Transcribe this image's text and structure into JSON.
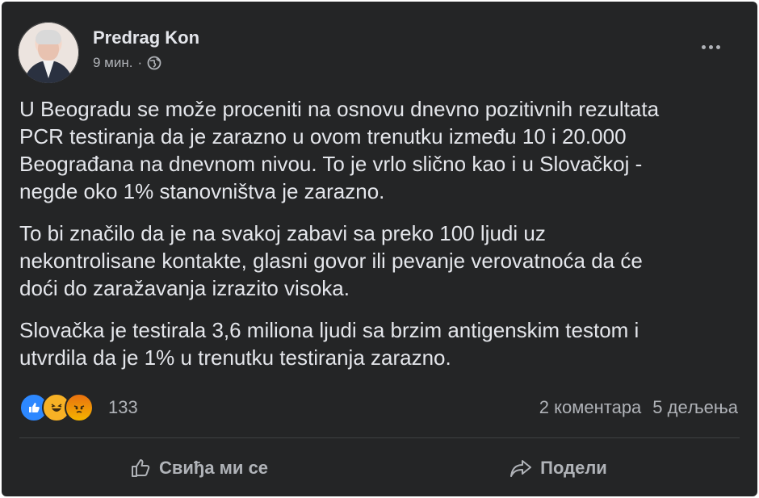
{
  "post": {
    "author": "Predrag Kon",
    "time": "9 мин.",
    "separator": "·",
    "visibility_icon": "globe-icon",
    "paragraphs": [
      "U Beogradu se može proceniti na osnovu dnevno pozitivnih rezultata\nPCR testiranja da je zarazno u ovom trenutku između 10 i 20.000\nBeograđana na dnevnom nivou. To je vrlo slično kao i u Slovačkoj -\nnegde oko 1% stanovništva je zarazno.",
      "To bi značilo da je na svakoj zabavi sa preko 100 ljudi uz\nnekontrolisane kontakte, glasni govor ili pevanje verovatnoća da će\ndoći do zaražavanja izrazito visoka.",
      "Slovačka je testirala 3,6 miliona ljudi sa brzim antigenskim testom i\nutvrdila da je 1% u trenutku testiranja zarazno."
    ]
  },
  "reactions": {
    "icons": [
      "like-icon",
      "haha-icon",
      "angry-icon"
    ],
    "count": "133"
  },
  "stats": {
    "comments": "2 коментара",
    "shares": "5 дељења"
  },
  "actions": {
    "like_label": "Свиђа ми се",
    "share_label": "Подели"
  },
  "colors": {
    "card_background": "#242526",
    "primary_text": "#e4e6eb",
    "secondary_text": "#b0b3b8",
    "like_blue": "#2d88ff"
  }
}
